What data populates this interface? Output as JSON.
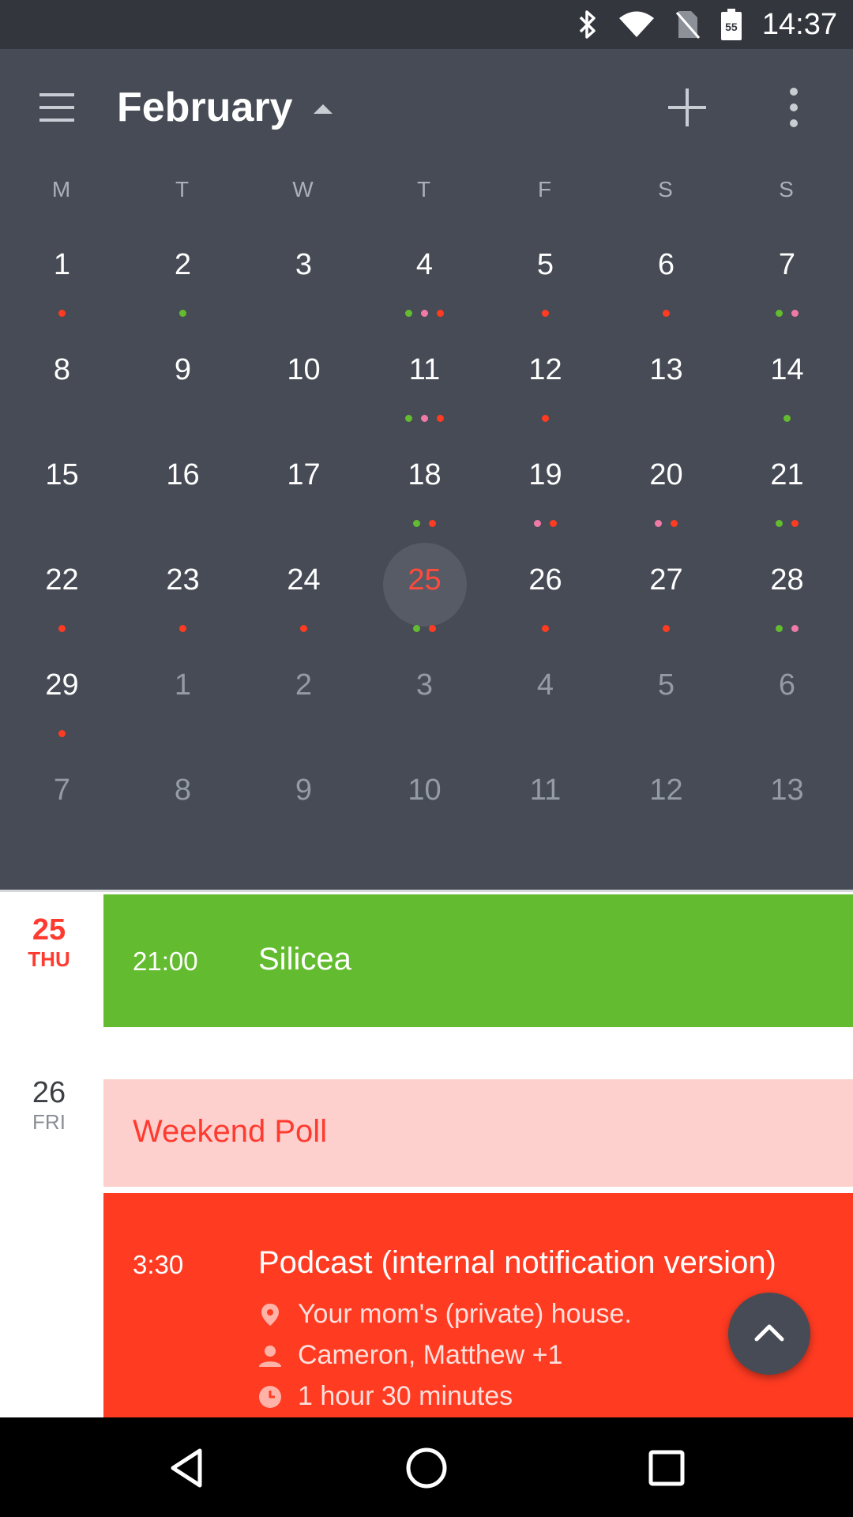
{
  "status_bar": {
    "time": "14:37",
    "battery_level": "55",
    "icons": [
      "bluetooth-icon",
      "wifi-icon",
      "no-sim-icon",
      "battery-icon"
    ]
  },
  "header": {
    "month": "February",
    "icons": [
      "menu-icon",
      "dropdown-caret-icon",
      "add-icon",
      "more-vert-icon"
    ]
  },
  "weekdays": [
    "M",
    "T",
    "W",
    "T",
    "F",
    "S",
    "S"
  ],
  "colors": {
    "green": "#63bc2f",
    "pink": "#f07aa6",
    "red": "#ff3b22",
    "header_bg": "#464b55",
    "today_text": "#ff4a3d"
  },
  "days": [
    {
      "label": "1",
      "dots": [
        "red"
      ]
    },
    {
      "label": "2",
      "dots": [
        "green"
      ]
    },
    {
      "label": "3",
      "dots": []
    },
    {
      "label": "4",
      "dots": [
        "green",
        "pink",
        "red"
      ]
    },
    {
      "label": "5",
      "dots": [
        "red"
      ]
    },
    {
      "label": "6",
      "dots": [
        "red"
      ]
    },
    {
      "label": "7",
      "dots": [
        "green",
        "pink"
      ]
    },
    {
      "label": "8",
      "dots": []
    },
    {
      "label": "9",
      "dots": []
    },
    {
      "label": "10",
      "dots": []
    },
    {
      "label": "11",
      "dots": [
        "green",
        "pink",
        "red"
      ]
    },
    {
      "label": "12",
      "dots": [
        "red"
      ]
    },
    {
      "label": "13",
      "dots": []
    },
    {
      "label": "14",
      "dots": [
        "green"
      ]
    },
    {
      "label": "15",
      "dots": []
    },
    {
      "label": "16",
      "dots": []
    },
    {
      "label": "17",
      "dots": []
    },
    {
      "label": "18",
      "dots": [
        "green",
        "red"
      ]
    },
    {
      "label": "19",
      "dots": [
        "pink",
        "red"
      ]
    },
    {
      "label": "20",
      "dots": [
        "pink",
        "red"
      ]
    },
    {
      "label": "21",
      "dots": [
        "green",
        "red"
      ]
    },
    {
      "label": "22",
      "dots": [
        "red"
      ]
    },
    {
      "label": "23",
      "dots": [
        "red"
      ]
    },
    {
      "label": "24",
      "dots": [
        "red"
      ]
    },
    {
      "label": "25",
      "dots": [
        "green",
        "red"
      ],
      "today": true
    },
    {
      "label": "26",
      "dots": [
        "red"
      ]
    },
    {
      "label": "27",
      "dots": [
        "red"
      ]
    },
    {
      "label": "28",
      "dots": [
        "green",
        "pink"
      ]
    },
    {
      "label": "29",
      "dots": [
        "red"
      ]
    },
    {
      "label": "1",
      "dots": [],
      "out": true
    },
    {
      "label": "2",
      "dots": [],
      "out": true
    },
    {
      "label": "3",
      "dots": [],
      "out": true
    },
    {
      "label": "4",
      "dots": [],
      "out": true
    },
    {
      "label": "5",
      "dots": [],
      "out": true
    },
    {
      "label": "6",
      "dots": [],
      "out": true
    },
    {
      "label": "7",
      "dots": [],
      "out": true
    },
    {
      "label": "8",
      "dots": [],
      "out": true
    },
    {
      "label": "9",
      "dots": [],
      "out": true
    },
    {
      "label": "10",
      "dots": [],
      "out": true
    },
    {
      "label": "11",
      "dots": [],
      "out": true
    },
    {
      "label": "12",
      "dots": [],
      "out": true
    },
    {
      "label": "13",
      "dots": [],
      "out": true
    }
  ],
  "agenda": {
    "day1": {
      "num": "25",
      "name": "THU"
    },
    "day2": {
      "num": "26",
      "name": "FRI"
    },
    "event_silicea": {
      "time": "21:00",
      "title": "Silicea",
      "color": "#63bc2f"
    },
    "event_poll": {
      "title": "Weekend Poll",
      "color": "#fdd0cd"
    },
    "event_podcast": {
      "time": "3:30",
      "title": "Podcast (internal notification version)",
      "location": "Your mom's (private) house.",
      "attendees": "Cameron, Matthew +1",
      "duration": "1 hour 30 minutes",
      "color": "#ff3b22",
      "icons": [
        "location-pin-icon",
        "person-icon",
        "clock-icon"
      ]
    }
  },
  "fab": {
    "icon": "chevron-up-icon"
  },
  "nav_bar": {
    "icons": [
      "back-icon",
      "home-icon",
      "recents-icon"
    ]
  }
}
